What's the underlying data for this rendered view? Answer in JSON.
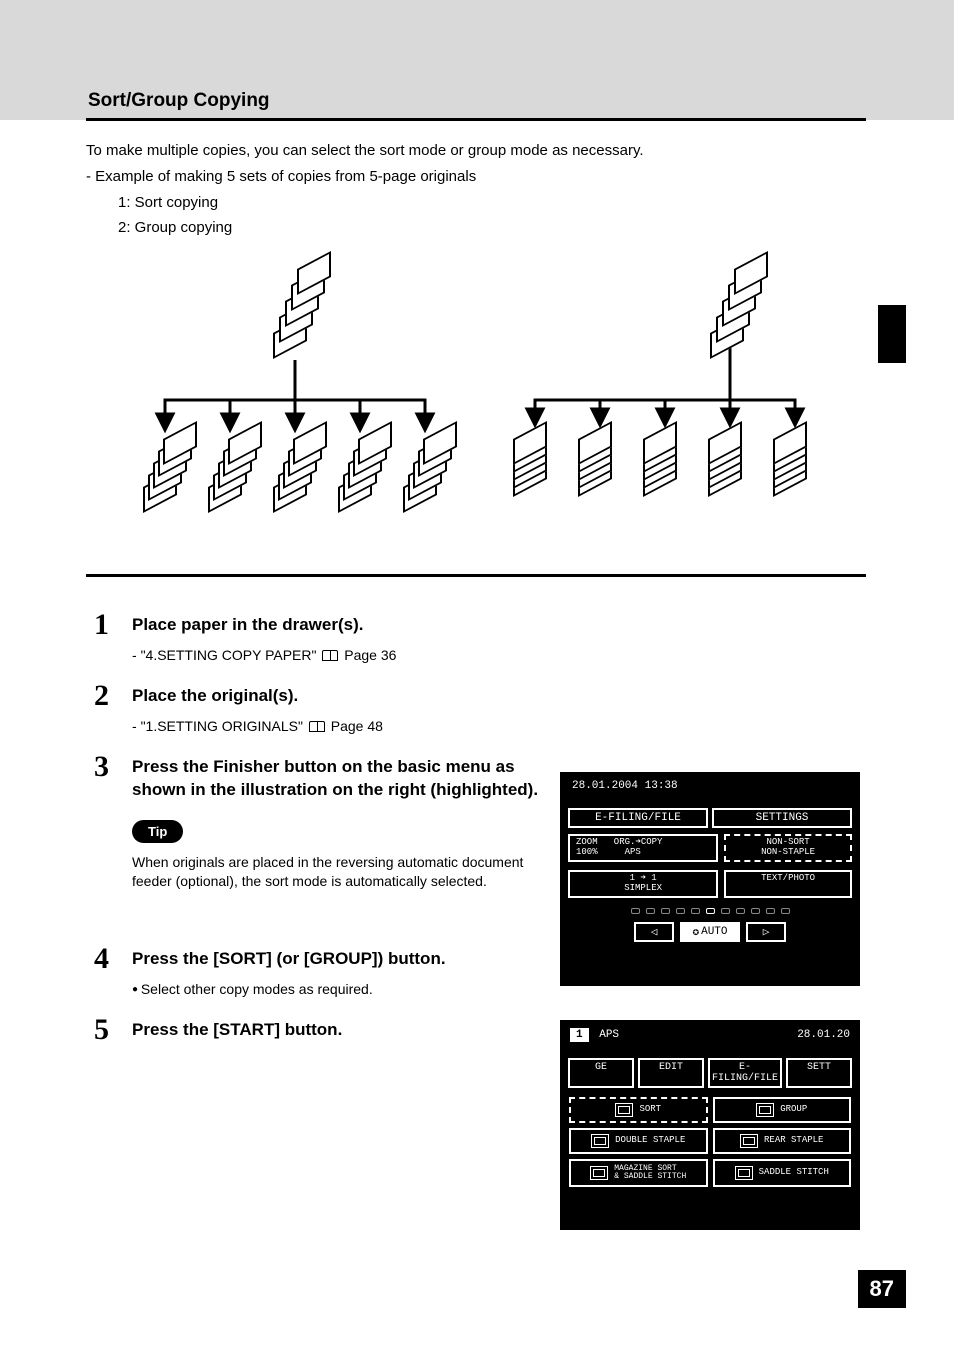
{
  "section_title": "Sort/Group Copying",
  "intro": {
    "lead": "To make multiple copies, you can select the sort mode or group mode as necessary.",
    "example_line": "Example of making 5 sets of copies from 5-page originals",
    "sub_items": [
      "1: Sort copying",
      "2: Group copying"
    ]
  },
  "steps": {
    "s1": {
      "num": "1",
      "title": "Place paper in the drawer(s).",
      "ref_label": "\"4.SETTING COPY PAPER\"",
      "ref_page": "Page 36"
    },
    "s2": {
      "num": "2",
      "title": "Place the original(s).",
      "ref_label": "\"1.SETTING ORIGINALS\"",
      "ref_page": "Page 48"
    },
    "s3": {
      "num": "3",
      "title": "Press the Finisher button on the basic menu as shown in the illustration on the right (highlighted).",
      "tip_label": "Tip",
      "tip_text": "When originals are placed in the reversing automatic document feeder (optional), the sort mode is automatically selected."
    },
    "s4": {
      "num": "4",
      "title": "Press the [SORT] (or [GROUP]) button.",
      "bullet": "Select other copy modes as required."
    },
    "s5": {
      "num": "5",
      "title": "Press the [START] button."
    }
  },
  "screen1": {
    "datetime": "28.01.2004 13:38",
    "tabs": [
      "E-FILING/FILE",
      "SETTINGS"
    ],
    "zoom_block": "ZOOM   ORG.➜COPY\n100%     APS",
    "nonsort": "NON-SORT\nNON-STAPLE",
    "simplex": "1 ➜ 1\nSIMPLEX",
    "mode": "TEXT/PHOTO",
    "auto": "AUTO",
    "nav_left": "◁",
    "nav_right": "▷"
  },
  "screen2": {
    "count": "1",
    "aps": "APS",
    "datetime": "28.01.20",
    "tabs": [
      "GE",
      "EDIT",
      "E-FILING/FILE",
      "SETT"
    ],
    "options": [
      {
        "label": "SORT"
      },
      {
        "label": "GROUP"
      },
      {
        "label": "DOUBLE STAPLE"
      },
      {
        "label": "REAR STAPLE"
      },
      {
        "label": "MAGAZINE SORT\n& SADDLE STITCH"
      },
      {
        "label": "SADDLE STITCH"
      }
    ]
  },
  "page_number": "87"
}
